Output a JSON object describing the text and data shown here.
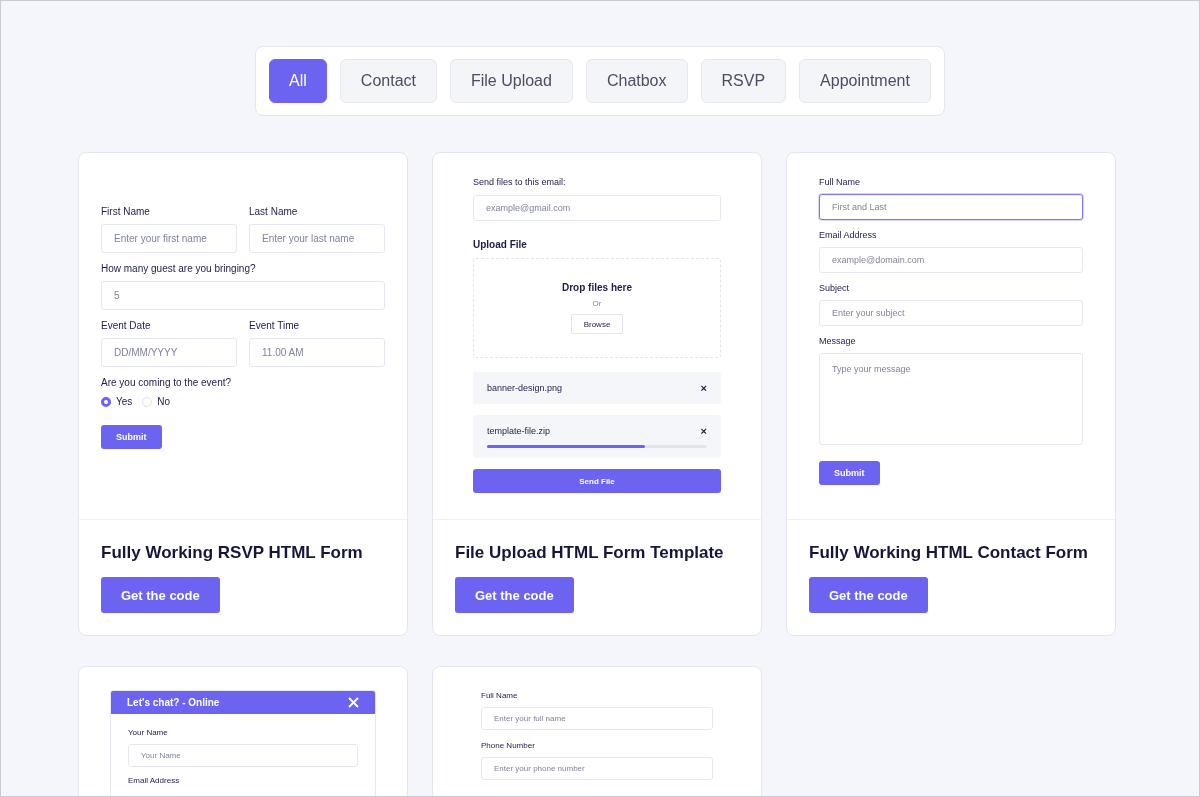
{
  "filters": [
    {
      "label": "All",
      "selected": true
    },
    {
      "label": "Contact",
      "selected": false
    },
    {
      "label": "File Upload",
      "selected": false
    },
    {
      "label": "Chatbox",
      "selected": false
    },
    {
      "label": "RSVP",
      "selected": false
    },
    {
      "label": "Appointment",
      "selected": false
    }
  ],
  "cards": [
    {
      "kind": "rsvp",
      "title": "Fully Working RSVP HTML Form",
      "button": "Get the code",
      "form": {
        "first": {
          "label": "First Name",
          "placeholder": "Enter your first name"
        },
        "last": {
          "label": "Last Name",
          "placeholder": "Enter your last name"
        },
        "guests": {
          "label": "How many guest are you bringing?",
          "placeholder": "5"
        },
        "date": {
          "label": "Event Date",
          "placeholder": "DD/MM/YYYY"
        },
        "time": {
          "label": "Event Time",
          "placeholder": "11.00 AM"
        },
        "question": "Are you coming to the event?",
        "options": [
          {
            "label": "Yes",
            "selected": true
          },
          {
            "label": "No",
            "selected": false
          }
        ],
        "submit": "Submit"
      }
    },
    {
      "kind": "upload",
      "title": "File Upload HTML Form Template",
      "button": "Get the code",
      "form": {
        "email": {
          "label": "Send files to this email:",
          "placeholder": "example@gmail.com"
        },
        "heading": "Upload File",
        "drop": "Drop files here",
        "or": "Or",
        "browse": "Browse",
        "files": [
          {
            "name": "banner-design.png",
            "close": "×"
          },
          {
            "name": "template-file.zip",
            "close": "×",
            "level": 0.72
          }
        ],
        "submit": "Send File"
      }
    },
    {
      "kind": "contact",
      "title": "Fully Working HTML Contact Form",
      "button": "Get the code",
      "form": {
        "fields": [
          {
            "label": "Full Name",
            "placeholder": "First and Last",
            "kind": "input",
            "focused": true
          },
          {
            "label": "Email Address",
            "placeholder": "example@domain.com",
            "kind": "input",
            "focused": false
          },
          {
            "label": "Subject",
            "placeholder": "Enter your subject",
            "kind": "input",
            "focused": false
          },
          {
            "label": "Message",
            "placeholder": "Type your message",
            "kind": "textarea",
            "focused": false
          }
        ],
        "submit": "Submit"
      }
    },
    {
      "kind": "chat",
      "form": {
        "header": "Let's chat? - Online",
        "fields": [
          {
            "label": "Your Name",
            "placeholder": "Your Name"
          },
          {
            "label": "Email Address"
          }
        ]
      }
    },
    {
      "kind": "appointment",
      "form": {
        "fields": [
          {
            "label": "Full Name",
            "placeholder": "Enter your full name"
          },
          {
            "label": "Phone Number",
            "placeholder": "Enter your phone number"
          }
        ]
      }
    }
  ]
}
